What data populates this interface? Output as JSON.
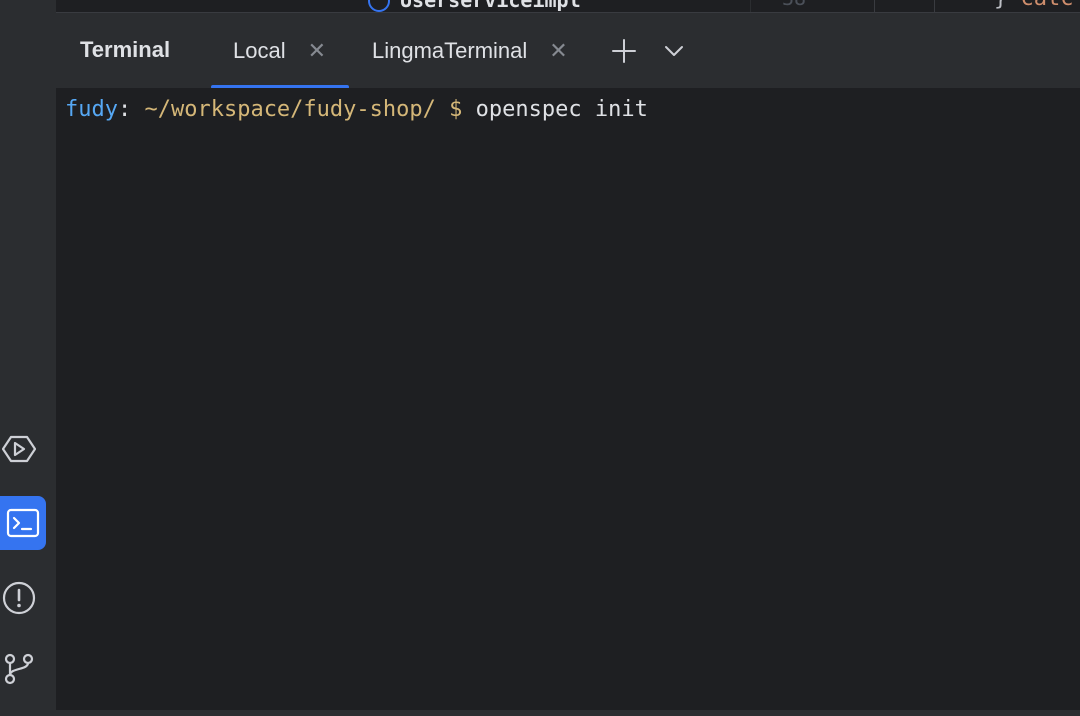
{
  "top_partial": {
    "file_name": "Userserviceimpl",
    "line_number": "38",
    "code_fragment_brace": "}",
    "code_fragment_keyword": "catc"
  },
  "terminal": {
    "title": "Terminal",
    "tabs": [
      {
        "label": "Local",
        "active": true
      },
      {
        "label": "LingmaTerminal",
        "active": false
      }
    ],
    "prompt": {
      "user": "fudy",
      "colon": ":",
      "path": "~/workspace/fudy-shop/",
      "dollar": "$",
      "command": "openspec init"
    }
  },
  "icons": {
    "close": "close-icon",
    "new_tab": "plus-icon",
    "tab_menu": "chevron-down-icon",
    "run": "run-icon",
    "terminal": "terminal-icon",
    "problems": "problems-icon",
    "git": "git-icon"
  },
  "colors": {
    "accent": "#3574f0",
    "background": "#1e1f22",
    "panel": "#2b2d30",
    "prompt_user": "#56a8f5",
    "prompt_path": "#d5b778"
  }
}
